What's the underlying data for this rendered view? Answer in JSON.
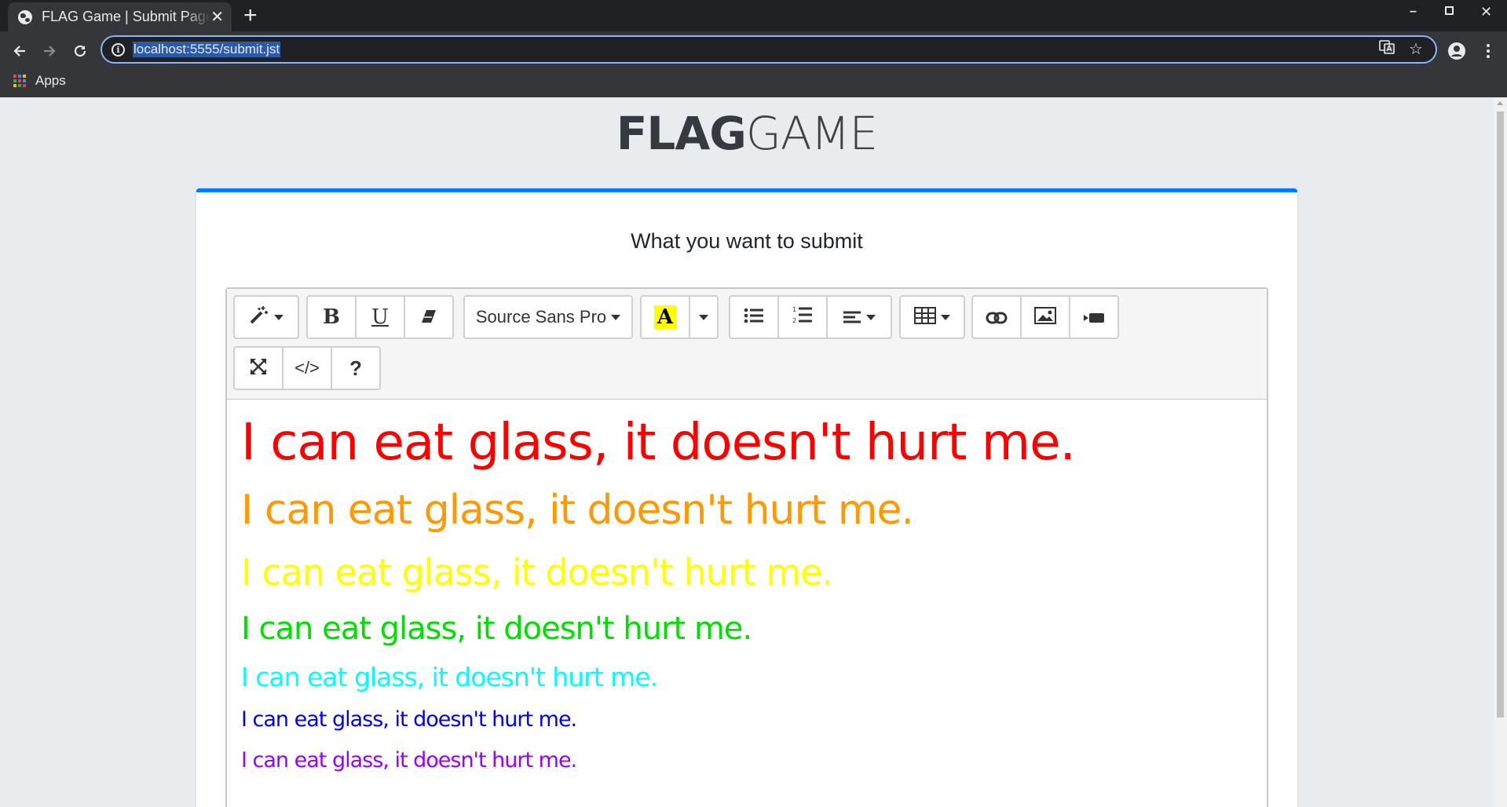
{
  "browser": {
    "tab_title": "FLAG Game | Submit Page",
    "new_tab": "+",
    "url": "localhost:5555/submit.jst",
    "bookmarks": {
      "apps_label": "Apps"
    }
  },
  "page": {
    "logo_bold": "FLAG",
    "logo_light": "GAME",
    "card_title": "What you want to submit",
    "accent_color": "#007bff"
  },
  "editor": {
    "font_name": "Source Sans Pro",
    "fore_color_label": "A",
    "help_label": "?",
    "bold_label": "B",
    "underline_label": "U",
    "code_label": "</>",
    "lines": [
      {
        "text": "I can eat glass, it doesn't hurt me.",
        "color": "#ff0000"
      },
      {
        "text": "I can eat glass, it doesn't hurt me.",
        "color": "#ff9900"
      },
      {
        "text": "I can eat glass, it doesn't hurt me.",
        "color": "#ffff00"
      },
      {
        "text": "I can eat glass, it doesn't hurt me.",
        "color": "#00e000"
      },
      {
        "text": "I can eat glass, it doesn't hurt me.",
        "color": "#00ffff"
      },
      {
        "text": "I can eat glass, it doesn't hurt me.",
        "color": "#0000ff"
      },
      {
        "text": "I can eat glass, it doesn't hurt me.",
        "color": "#9900ff"
      }
    ]
  },
  "icons": {
    "tab": "globe-icon",
    "nav": [
      "back-icon",
      "forward-icon",
      "reload-icon",
      "info-icon"
    ],
    "omnibox": [
      "translate-icon",
      "star-icon",
      "account-icon",
      "menu-icon"
    ],
    "toolbar": [
      "magic-wand-icon",
      "eraser-icon",
      "unordered-list-icon",
      "ordered-list-icon",
      "align-icon",
      "table-icon",
      "link-icon",
      "picture-icon",
      "video-icon",
      "fullscreen-icon"
    ]
  }
}
